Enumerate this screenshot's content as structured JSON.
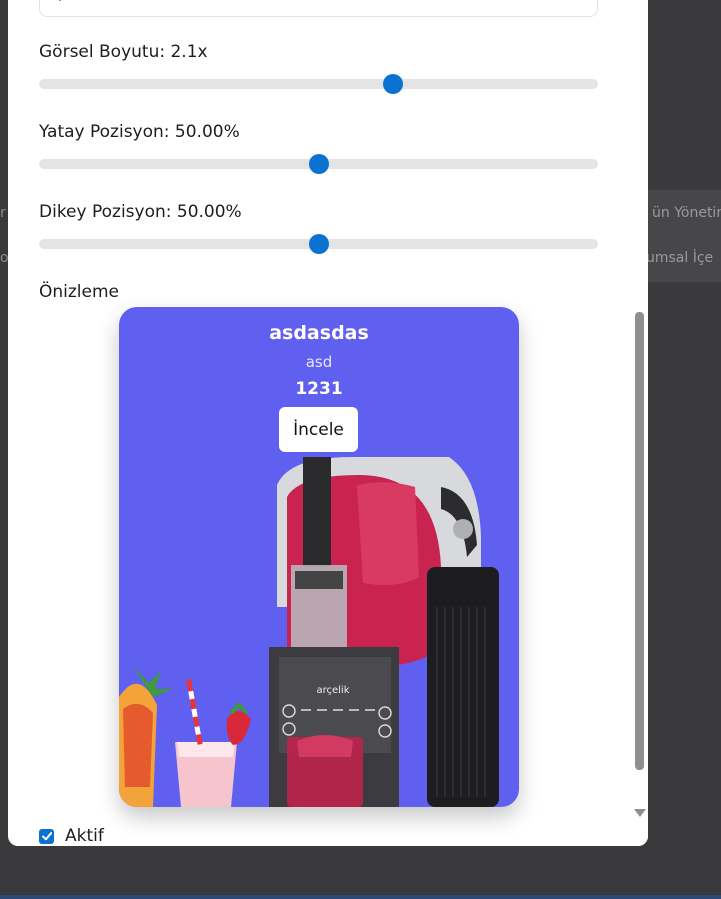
{
  "background": {
    "right_texts": [
      "ün Yönetin",
      "umsal İçe"
    ],
    "left_glyphs": [
      "r",
      "o"
    ]
  },
  "form": {
    "top_input_value": "p",
    "size_label": "Görsel Boyutu: 2.1x",
    "size_value": 0.634,
    "horizontal_label": "Yatay Pozisyon: 50.00%",
    "horizontal_value": 0.5,
    "vertical_label": "Dikey Pozisyon: 50.00%",
    "vertical_value": 0.5,
    "preview_label": "Önizleme",
    "active_label": "Aktif",
    "active_checked": true
  },
  "preview_card": {
    "title": "asdasdas",
    "subtitle": "asd",
    "price": "1231",
    "button_label": "İncele",
    "background_color": "#5f5ff0",
    "brand_text": "arçelik"
  },
  "colors": {
    "accent": "#0b72d1",
    "track": "#e4e4e7"
  }
}
